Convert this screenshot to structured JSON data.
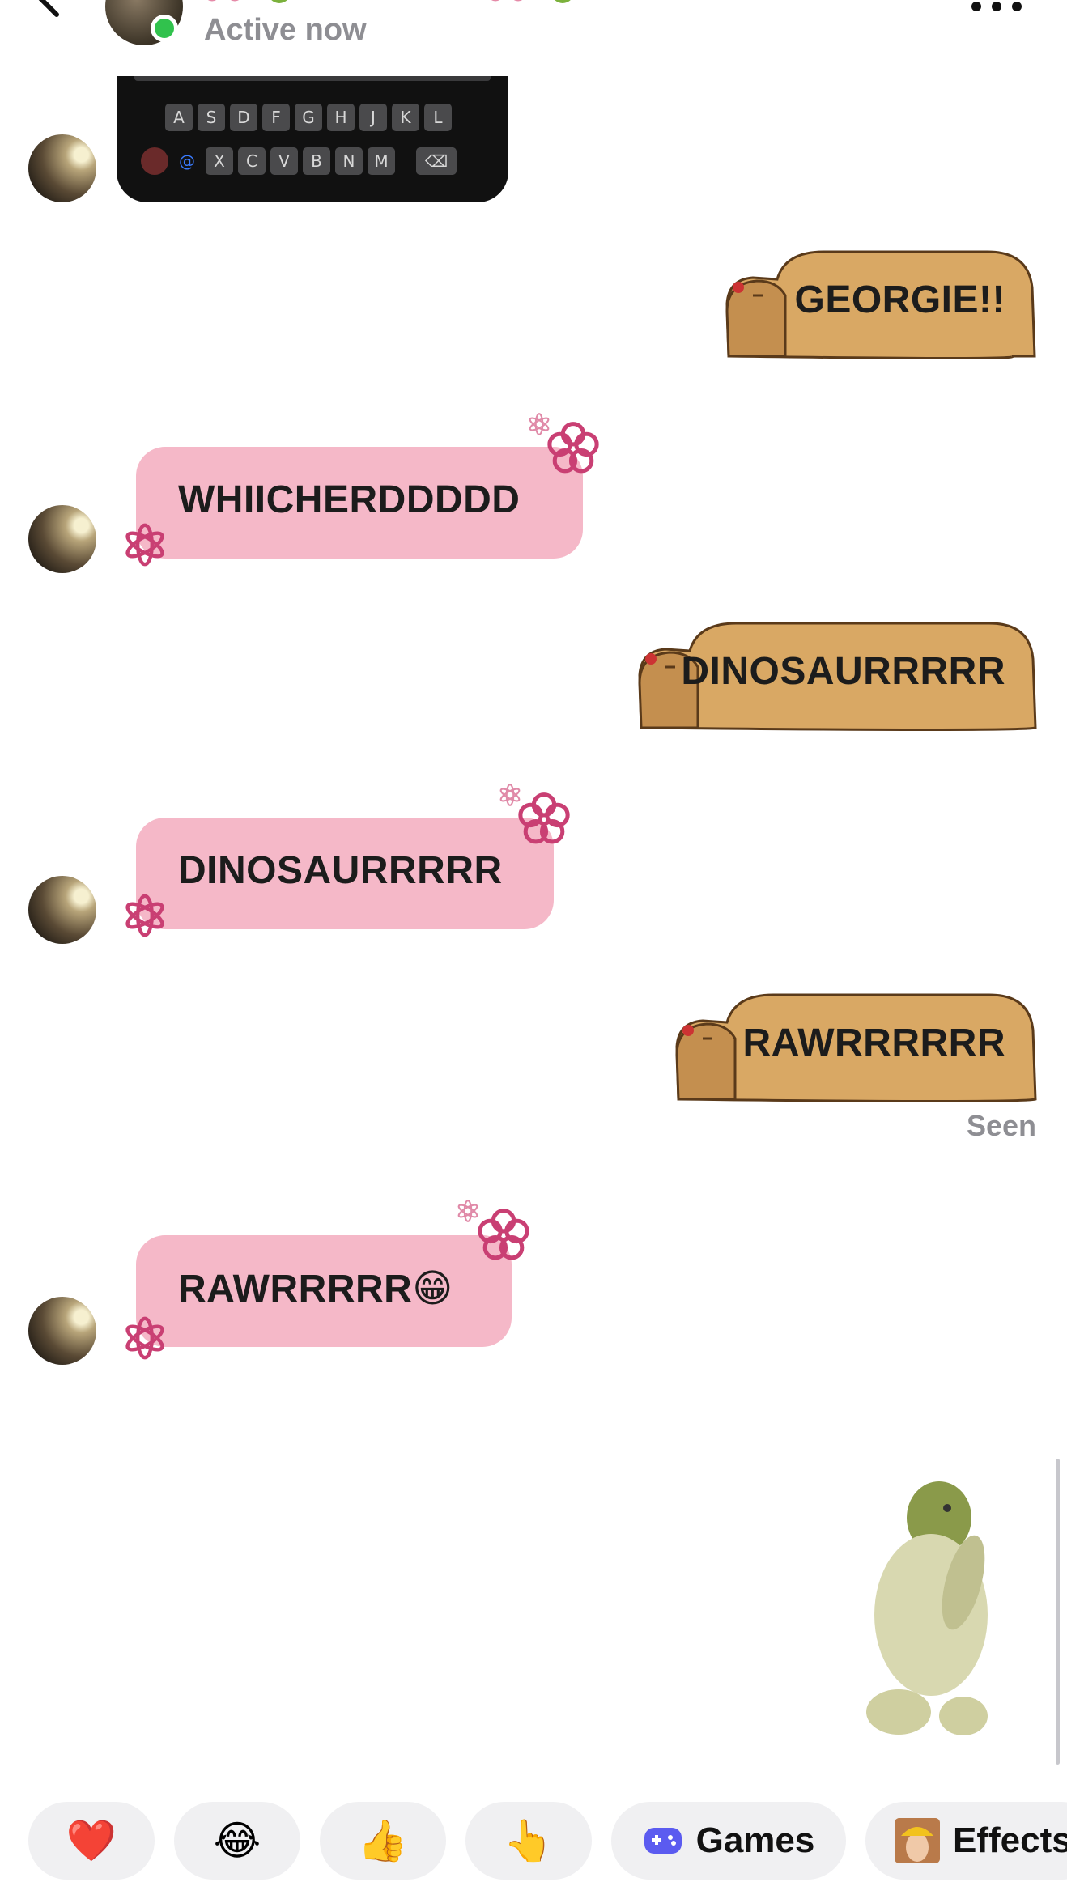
{
  "header": {
    "status": "Active now",
    "status_color": "#31c24d"
  },
  "keyboard_image": {
    "row1": [
      "A",
      "S",
      "D",
      "F",
      "G",
      "H",
      "J",
      "K",
      "L"
    ],
    "row2": [
      "X",
      "C",
      "V",
      "B",
      "N",
      "M",
      "⌫"
    ]
  },
  "messages": [
    {
      "from": "me",
      "text": "GEORGIE!!"
    },
    {
      "from": "them",
      "text": "WHIICHERDDDDD"
    },
    {
      "from": "me",
      "text": "DINOSAURRRRR"
    },
    {
      "from": "them",
      "text": "DINOSAURRRRR"
    },
    {
      "from": "me",
      "text": "RAWRRRRRR"
    },
    {
      "from": "them",
      "text": "RAWRRRRR😁"
    }
  ],
  "seen_label": "Seen",
  "quick_bar": {
    "items": [
      {
        "icon": "❤️"
      },
      {
        "icon": "😂"
      },
      {
        "icon": "👍"
      },
      {
        "icon": "👆"
      },
      {
        "label": "Games"
      },
      {
        "label": "Effects"
      }
    ]
  },
  "colors": {
    "received_bubble": "#f5b8c8",
    "sent_capybara": "#d9a864",
    "flower": "#c93f73"
  }
}
